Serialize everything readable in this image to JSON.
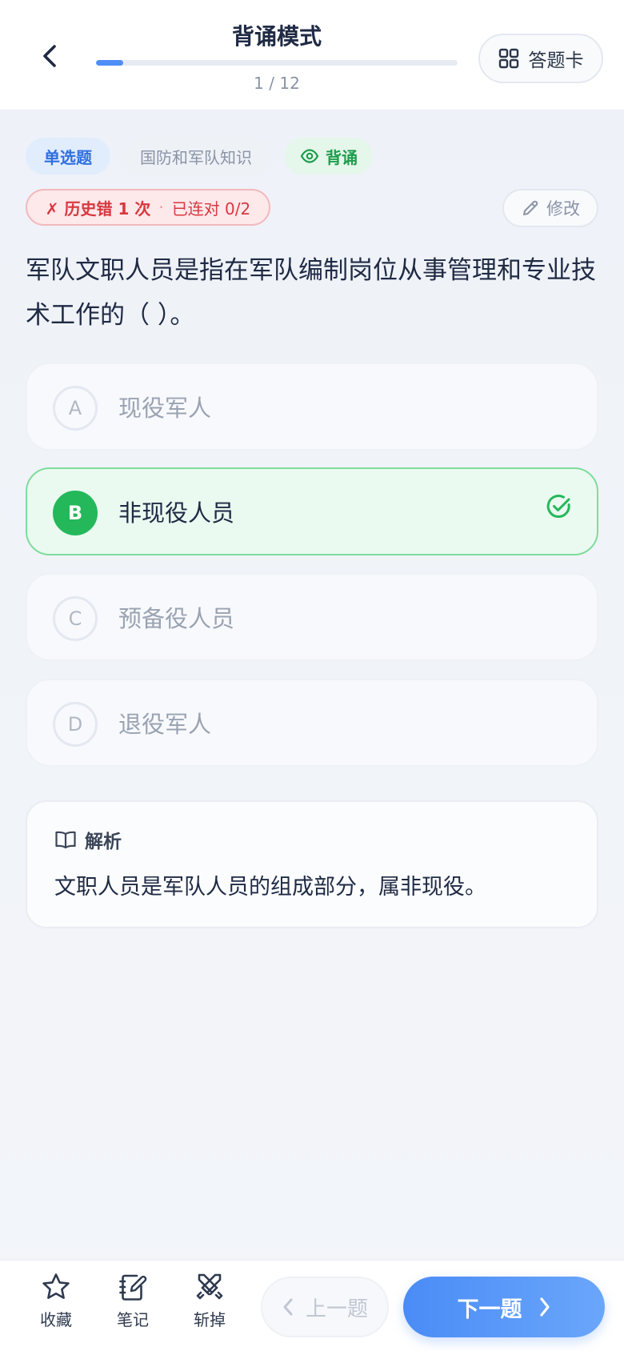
{
  "header": {
    "title": "背诵模式",
    "progress_text": "1 / 12",
    "progress_fraction": 0.075,
    "answer_card_label": "答题卡",
    "back_icon": "chevron-left-icon",
    "card_icon": "grid-icon"
  },
  "tags": {
    "type": "单选题",
    "category": "国防和军队知识",
    "mode": "背诵",
    "mode_icon": "eye-icon"
  },
  "history": {
    "wrong": "✗ 历史错 1 次",
    "separator": "·",
    "streak": "已连对 0/2"
  },
  "edit": {
    "label": "修改",
    "icon": "pencil-icon"
  },
  "question": "军队文职人员是指在军队编制岗位从事管理和专业技术工作的（ ）。",
  "options": [
    {
      "letter": "A",
      "text": "现役军人",
      "correct": false
    },
    {
      "letter": "B",
      "text": "非现役人员",
      "correct": true
    },
    {
      "letter": "C",
      "text": "预备役人员",
      "correct": false
    },
    {
      "letter": "D",
      "text": "退役军人",
      "correct": false
    }
  ],
  "analysis": {
    "title": "解析",
    "icon": "book-icon",
    "body": "文职人员是军队人员的组成部分，属非现役。"
  },
  "bottom": {
    "favorite_label": "收藏",
    "note_label": "笔记",
    "remove_label": "斩掉",
    "prev_label": "上一题",
    "next_label": "下一题"
  },
  "colors": {
    "accent": "#4f8ef7",
    "correct": "#24b85b",
    "error": "#d8383f"
  }
}
